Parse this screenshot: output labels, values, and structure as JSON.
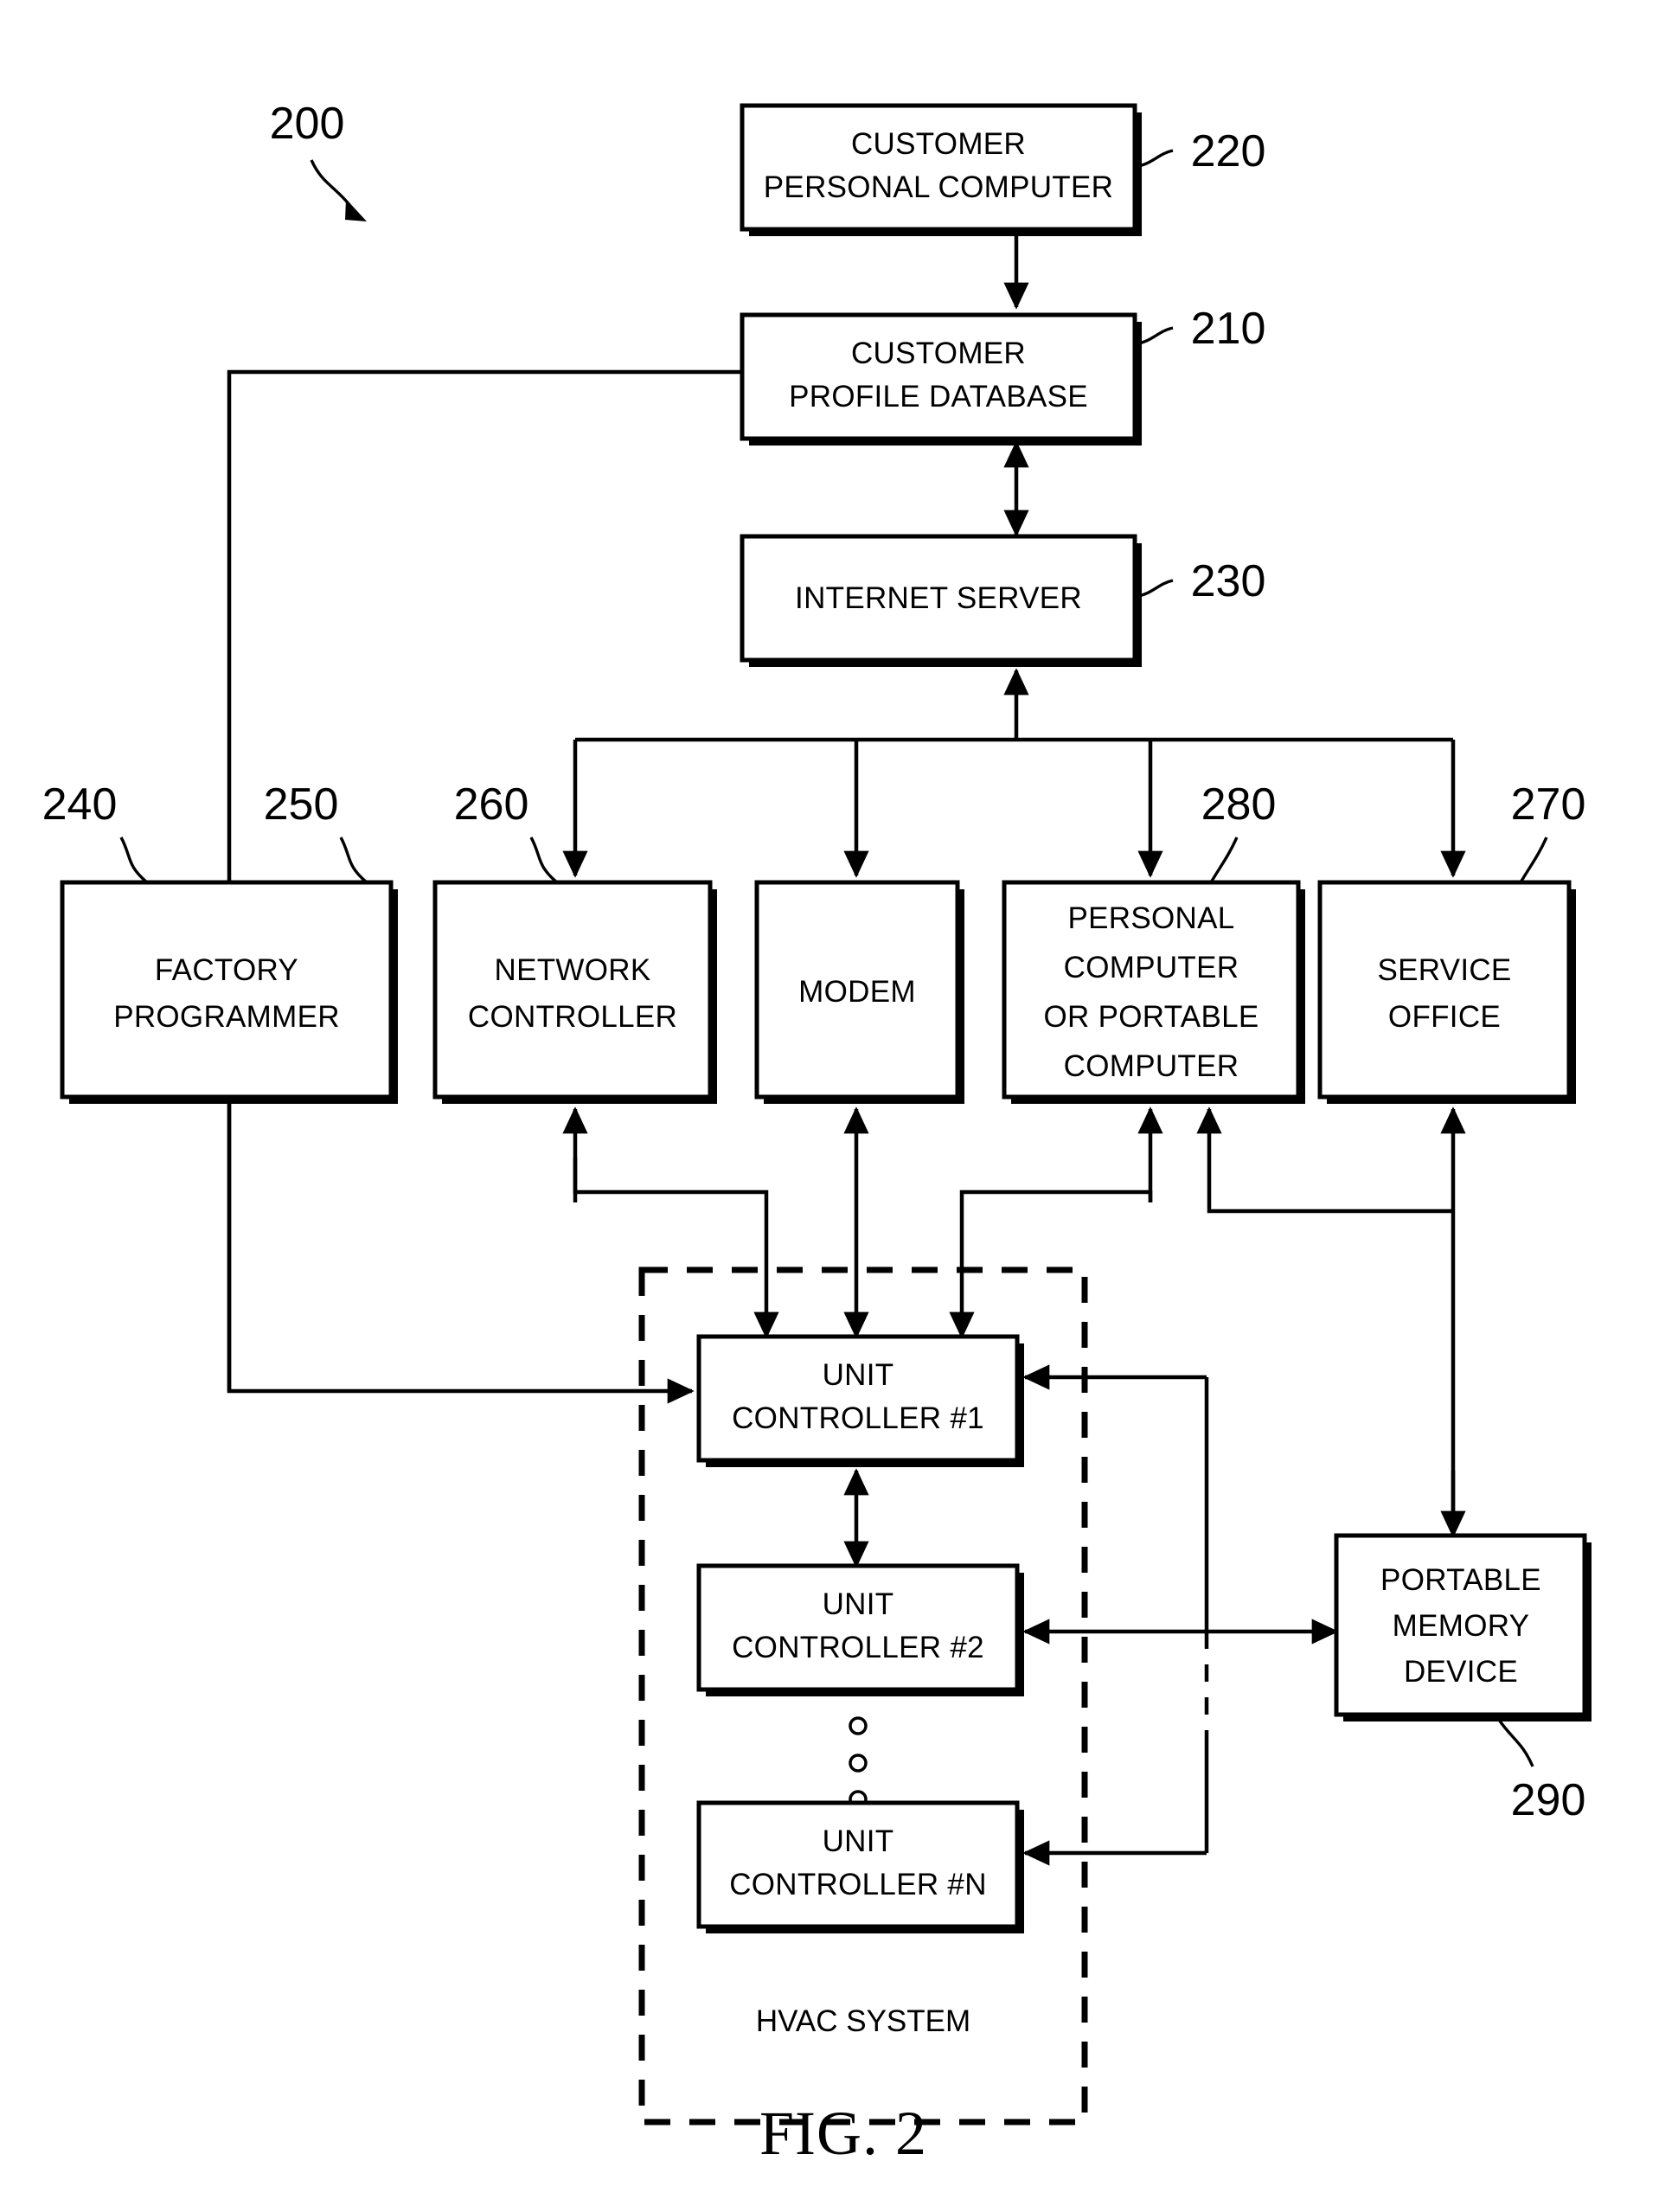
{
  "figure": {
    "caption": "FIG. 2",
    "system_ref": "200"
  },
  "nodes": [
    {
      "id": "customer_pc",
      "ref": "220",
      "lines": [
        "CUSTOMER",
        "PERSONAL COMPUTER"
      ]
    },
    {
      "id": "customer_profile_db",
      "ref": "210",
      "lines": [
        "CUSTOMER",
        "PROFILE DATABASE"
      ]
    },
    {
      "id": "internet_server",
      "ref": "230",
      "lines": [
        "INTERNET SERVER"
      ]
    },
    {
      "id": "factory_programmer",
      "ref": "240",
      "lines": [
        "FACTORY",
        "PROGRAMMER"
      ]
    },
    {
      "id": "network_controller",
      "ref": "250",
      "lines": [
        "NETWORK",
        "CONTROLLER"
      ]
    },
    {
      "id": "modem",
      "ref": "260",
      "lines": [
        "MODEM"
      ]
    },
    {
      "id": "personal_computer",
      "ref": "280",
      "lines": [
        "PERSONAL",
        "COMPUTER",
        "OR PORTABLE",
        "COMPUTER"
      ]
    },
    {
      "id": "service_office",
      "ref": "270",
      "lines": [
        "SERVICE",
        "OFFICE"
      ]
    },
    {
      "id": "unit_controller_1",
      "ref": "",
      "lines": [
        "UNIT",
        "CONTROLLER #1"
      ]
    },
    {
      "id": "unit_controller_2",
      "ref": "",
      "lines": [
        "UNIT",
        "CONTROLLER #2"
      ]
    },
    {
      "id": "unit_controller_n",
      "ref": "",
      "lines": [
        "UNIT",
        "CONTROLLER #N"
      ]
    },
    {
      "id": "portable_memory",
      "ref": "290",
      "lines": [
        "PORTABLE",
        "MEMORY",
        "DEVICE"
      ]
    }
  ],
  "group": {
    "id": "hvac_system",
    "label": "HVAC SYSTEM"
  },
  "labels": {
    "customer_pc_l1": "CUSTOMER",
    "customer_pc_l2": "PERSONAL COMPUTER",
    "customer_db_l1": "CUSTOMER",
    "customer_db_l2": "PROFILE DATABASE",
    "internet_server_l1": "INTERNET SERVER",
    "factory_programmer_l1": "FACTORY",
    "factory_programmer_l2": "PROGRAMMER",
    "network_controller_l1": "NETWORK",
    "network_controller_l2": "CONTROLLER",
    "modem_l1": "MODEM",
    "personal_computer_l1": "PERSONAL",
    "personal_computer_l2": "COMPUTER",
    "personal_computer_l3": "OR PORTABLE",
    "personal_computer_l4": "COMPUTER",
    "service_office_l1": "SERVICE",
    "service_office_l2": "OFFICE",
    "unit_controller_1_l1": "UNIT",
    "unit_controller_1_l2": "CONTROLLER #1",
    "unit_controller_2_l1": "UNIT",
    "unit_controller_2_l2": "CONTROLLER #2",
    "unit_controller_n_l1": "UNIT",
    "unit_controller_n_l2": "CONTROLLER #N",
    "portable_memory_l1": "PORTABLE",
    "portable_memory_l2": "MEMORY",
    "portable_memory_l3": "DEVICE",
    "hvac_system": "HVAC SYSTEM",
    "fig_caption": "FIG. 2"
  },
  "refs": {
    "system": "200",
    "customer_profile_db": "210",
    "customer_pc": "220",
    "internet_server": "230",
    "factory_programmer": "240",
    "network_controller": "250",
    "modem": "260",
    "service_office": "270",
    "personal_computer": "280",
    "portable_memory": "290"
  },
  "colors": {
    "stroke": "#000000",
    "fill": "#ffffff"
  }
}
